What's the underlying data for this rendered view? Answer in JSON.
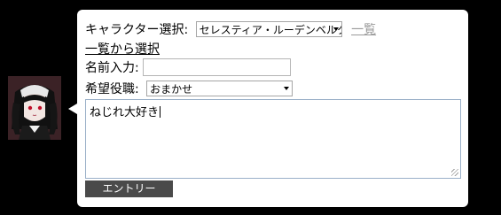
{
  "form": {
    "character_label": "キャラクター選択:",
    "character_selected": "セレスティア・ルーデンベルク",
    "list_link": "一覧",
    "select_from_list_link": "一覧から選択",
    "name_label": "名前入力:",
    "name_value": "",
    "role_label": "希望役職:",
    "role_selected": "おまかせ",
    "message_text": "ねじれ大好き",
    "entry_button": "エントリー"
  },
  "avatar": {
    "icon": "character-portrait"
  }
}
